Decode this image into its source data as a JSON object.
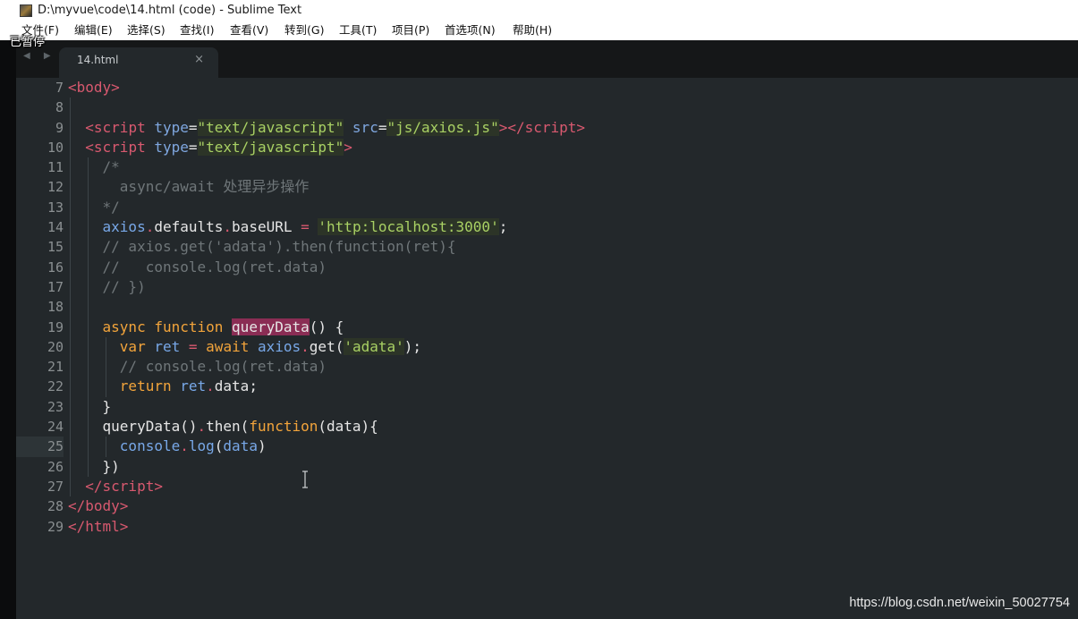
{
  "window": {
    "title": "D:\\myvue\\code\\14.html (code) - Sublime Text",
    "paused_overlay": "已暂停"
  },
  "menu": {
    "items": [
      {
        "label": "文件(F)"
      },
      {
        "label": "编辑(E)"
      },
      {
        "label": "选择(S)"
      },
      {
        "label": "查找(I)"
      },
      {
        "label": "查看(V)"
      },
      {
        "label": "转到(G)"
      },
      {
        "label": "工具(T)"
      },
      {
        "label": "项目(P)"
      },
      {
        "label": "首选项(N)"
      },
      {
        "label": "帮助(H)"
      }
    ]
  },
  "tabs": [
    {
      "label": "14.html",
      "close": "×",
      "active": true
    }
  ],
  "nav": {
    "arrows": "◀ ▶"
  },
  "editor": {
    "active_line": 25,
    "lines": [
      {
        "n": "7",
        "guides": 0,
        "tokens": [
          [
            "<",
            "tag"
          ],
          [
            "body",
            "tag"
          ],
          [
            ">",
            "tag"
          ]
        ]
      },
      {
        "n": "8",
        "guides": 1,
        "tokens": []
      },
      {
        "n": "9",
        "guides": 1,
        "tokens": [
          [
            "  ",
            "pl"
          ],
          [
            "<",
            "tag"
          ],
          [
            "script",
            "tag"
          ],
          [
            " ",
            "pl"
          ],
          [
            "type",
            "attr"
          ],
          [
            "=",
            "pl"
          ],
          [
            "\"text/javascript\"",
            "str"
          ],
          [
            " ",
            "pl"
          ],
          [
            "src",
            "attr"
          ],
          [
            "=",
            "pl"
          ],
          [
            "\"js/axios.js\"",
            "str"
          ],
          [
            "></",
            "tag"
          ],
          [
            "script",
            "tag"
          ],
          [
            ">",
            "tag"
          ]
        ]
      },
      {
        "n": "10",
        "guides": 1,
        "tokens": [
          [
            "  ",
            "pl"
          ],
          [
            "<",
            "tag"
          ],
          [
            "script",
            "tag"
          ],
          [
            " ",
            "pl"
          ],
          [
            "type",
            "attr"
          ],
          [
            "=",
            "pl"
          ],
          [
            "\"text/javascript\"",
            "str"
          ],
          [
            ">",
            "tag"
          ]
        ]
      },
      {
        "n": "11",
        "guides": 2,
        "tokens": [
          [
            "    ",
            "pl"
          ],
          [
            "/*",
            "cm"
          ]
        ]
      },
      {
        "n": "12",
        "guides": 2,
        "tokens": [
          [
            "      ",
            "pl"
          ],
          [
            "async/await 处理异步操作",
            "cm"
          ]
        ]
      },
      {
        "n": "13",
        "guides": 2,
        "tokens": [
          [
            "    ",
            "pl"
          ],
          [
            "*/",
            "cm"
          ]
        ]
      },
      {
        "n": "14",
        "guides": 2,
        "tokens": [
          [
            "    ",
            "pl"
          ],
          [
            "axios",
            "var"
          ],
          [
            ".",
            "op"
          ],
          [
            "defaults",
            "id"
          ],
          [
            ".",
            "op"
          ],
          [
            "baseURL",
            "id"
          ],
          [
            " ",
            "pl"
          ],
          [
            "=",
            "op"
          ],
          [
            " ",
            "pl"
          ],
          [
            "'http:localhost:3000'",
            "str"
          ],
          [
            ";",
            "pl"
          ]
        ]
      },
      {
        "n": "15",
        "guides": 2,
        "tokens": [
          [
            "    ",
            "pl"
          ],
          [
            "// axios.get('adata').then(function(ret){",
            "cm"
          ]
        ]
      },
      {
        "n": "16",
        "guides": 2,
        "tokens": [
          [
            "    ",
            "pl"
          ],
          [
            "//   console.log(ret.data)",
            "cm"
          ]
        ]
      },
      {
        "n": "17",
        "guides": 2,
        "tokens": [
          [
            "    ",
            "pl"
          ],
          [
            "// })",
            "cm"
          ]
        ]
      },
      {
        "n": "18",
        "guides": 2,
        "tokens": []
      },
      {
        "n": "19",
        "guides": 2,
        "tokens": [
          [
            "    ",
            "pl"
          ],
          [
            "async",
            "kw"
          ],
          [
            " ",
            "pl"
          ],
          [
            "function",
            "kw"
          ],
          [
            " ",
            "pl"
          ],
          [
            "queryData",
            "hl"
          ],
          [
            "() {",
            "pl"
          ]
        ]
      },
      {
        "n": "20",
        "guides": 3,
        "tokens": [
          [
            "      ",
            "pl"
          ],
          [
            "var",
            "kw"
          ],
          [
            " ",
            "pl"
          ],
          [
            "ret",
            "var"
          ],
          [
            " ",
            "pl"
          ],
          [
            "=",
            "op"
          ],
          [
            " ",
            "pl"
          ],
          [
            "await",
            "kw"
          ],
          [
            " ",
            "pl"
          ],
          [
            "axios",
            "var"
          ],
          [
            ".",
            "op"
          ],
          [
            "get(",
            "id"
          ],
          [
            "'adata'",
            "str"
          ],
          [
            ");",
            "pl"
          ]
        ]
      },
      {
        "n": "21",
        "guides": 3,
        "tokens": [
          [
            "      ",
            "pl"
          ],
          [
            "// console.log(ret.data)",
            "cm"
          ]
        ]
      },
      {
        "n": "22",
        "guides": 3,
        "tokens": [
          [
            "      ",
            "pl"
          ],
          [
            "return",
            "kw"
          ],
          [
            " ",
            "pl"
          ],
          [
            "ret",
            "var"
          ],
          [
            ".",
            "op"
          ],
          [
            "data;",
            "id"
          ]
        ]
      },
      {
        "n": "23",
        "guides": 2,
        "tokens": [
          [
            "    ",
            "pl"
          ],
          [
            "}",
            "pl"
          ]
        ]
      },
      {
        "n": "24",
        "guides": 2,
        "tokens": [
          [
            "    ",
            "pl"
          ],
          [
            "queryData()",
            "id"
          ],
          [
            ".",
            "op"
          ],
          [
            "then(",
            "id"
          ],
          [
            "function",
            "kw"
          ],
          [
            "(data){",
            "pl"
          ]
        ]
      },
      {
        "n": "25",
        "guides": 3,
        "tokens": [
          [
            "      ",
            "pl"
          ],
          [
            "console",
            "var"
          ],
          [
            ".",
            "op"
          ],
          [
            "log",
            "var"
          ],
          [
            "(",
            "pl"
          ],
          [
            "data",
            "var"
          ],
          [
            ")",
            "pl"
          ]
        ]
      },
      {
        "n": "26",
        "guides": 2,
        "tokens": [
          [
            "    ",
            "pl"
          ],
          [
            "})",
            "pl"
          ]
        ]
      },
      {
        "n": "27",
        "guides": 1,
        "tokens": [
          [
            "  ",
            "pl"
          ],
          [
            "</",
            "tag"
          ],
          [
            "script",
            "tag"
          ],
          [
            ">",
            "tag"
          ]
        ]
      },
      {
        "n": "28",
        "guides": 0,
        "tokens": [
          [
            "</",
            "tag"
          ],
          [
            "body",
            "tag"
          ],
          [
            ">",
            "tag"
          ]
        ]
      },
      {
        "n": "29",
        "guides": 0,
        "tokens": [
          [
            "</",
            "tag"
          ],
          [
            "html",
            "tag"
          ],
          [
            ">",
            "tag"
          ]
        ]
      }
    ]
  },
  "watermark": "https://blog.csdn.net/weixin_50027754",
  "colors": {
    "background": "#23282b",
    "tag": "#d8596f",
    "string": "#a9d164",
    "keyword": "#f2a43b",
    "comment": "#6f7679",
    "attribute": "#7fa7e0"
  }
}
